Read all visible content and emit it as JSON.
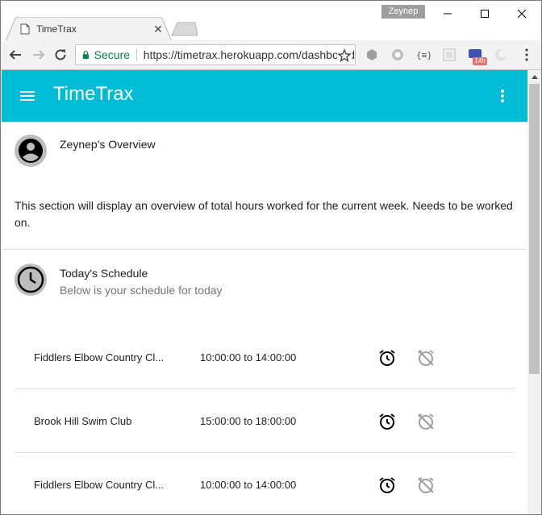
{
  "browser": {
    "profile_name": "Zeynep",
    "tab_title": "TimeTrax",
    "secure_label": "Secure",
    "url": "https://timetrax.herokuapp.com/dashboard",
    "extension_badge": "14h"
  },
  "appbar": {
    "title": "TimeTrax",
    "color": "#00bcd4"
  },
  "overview": {
    "title": "Zeynep's Overview",
    "text": "This section will display an overview of total hours worked for the current week. Needs to be worked on."
  },
  "schedule": {
    "title": "Today's Schedule",
    "subtitle": "Below is your schedule for today",
    "rows": [
      {
        "name": "Fiddlers Elbow Country Cl...",
        "time": "10:00:00 to 14:00:00"
      },
      {
        "name": "Brook Hill Swim Club",
        "time": "15:00:00 to 18:00:00"
      },
      {
        "name": "Fiddlers Elbow Country Cl...",
        "time": "10:00:00 to 14:00:00"
      }
    ]
  }
}
